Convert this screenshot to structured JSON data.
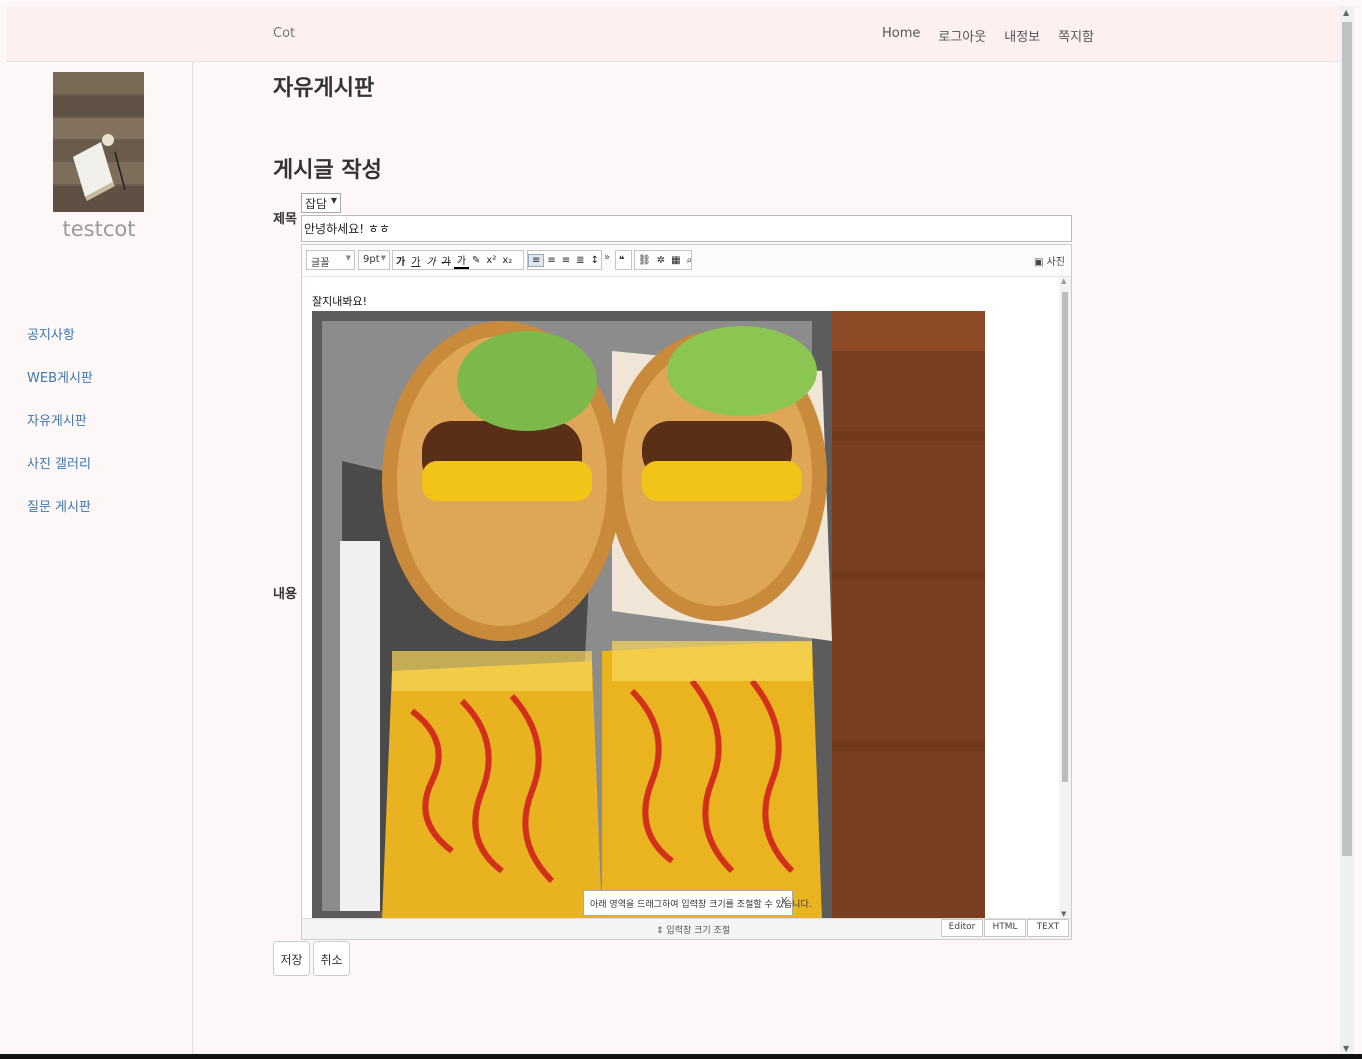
{
  "navbar": {
    "brand": "Cot",
    "links": [
      "Home",
      "로그아웃",
      "내정보",
      "쪽지함"
    ]
  },
  "sidebar": {
    "username": "testcot",
    "menu": [
      "공지사항",
      "WEB게시판",
      "자유게시판",
      "사진 갤러리",
      "질문 게시판"
    ]
  },
  "page": {
    "board_title": "자유게시판",
    "form_title": "게시글 작성"
  },
  "form": {
    "title_label": "제목",
    "category": "잡담",
    "title_value": "안녕하세요! ㅎㅎ",
    "content_label": "내용"
  },
  "editor": {
    "font_select": "글꼴",
    "size_select": "9pt",
    "format_buttons": [
      "가",
      "가",
      "가",
      "가",
      "가"
    ],
    "photo_button": "사진",
    "more_symbol": "»",
    "body_text": "잘지내봐요!",
    "tooltip": "아래 영역을 드래그하여 입력창 크기를 조절할 수 있습니다.",
    "tooltip_close": "X",
    "resize_label": "입력창 크기 조절",
    "modes": [
      "Editor",
      "HTML",
      "TEXT"
    ]
  },
  "actions": {
    "save": "저장",
    "cancel": "취소"
  }
}
